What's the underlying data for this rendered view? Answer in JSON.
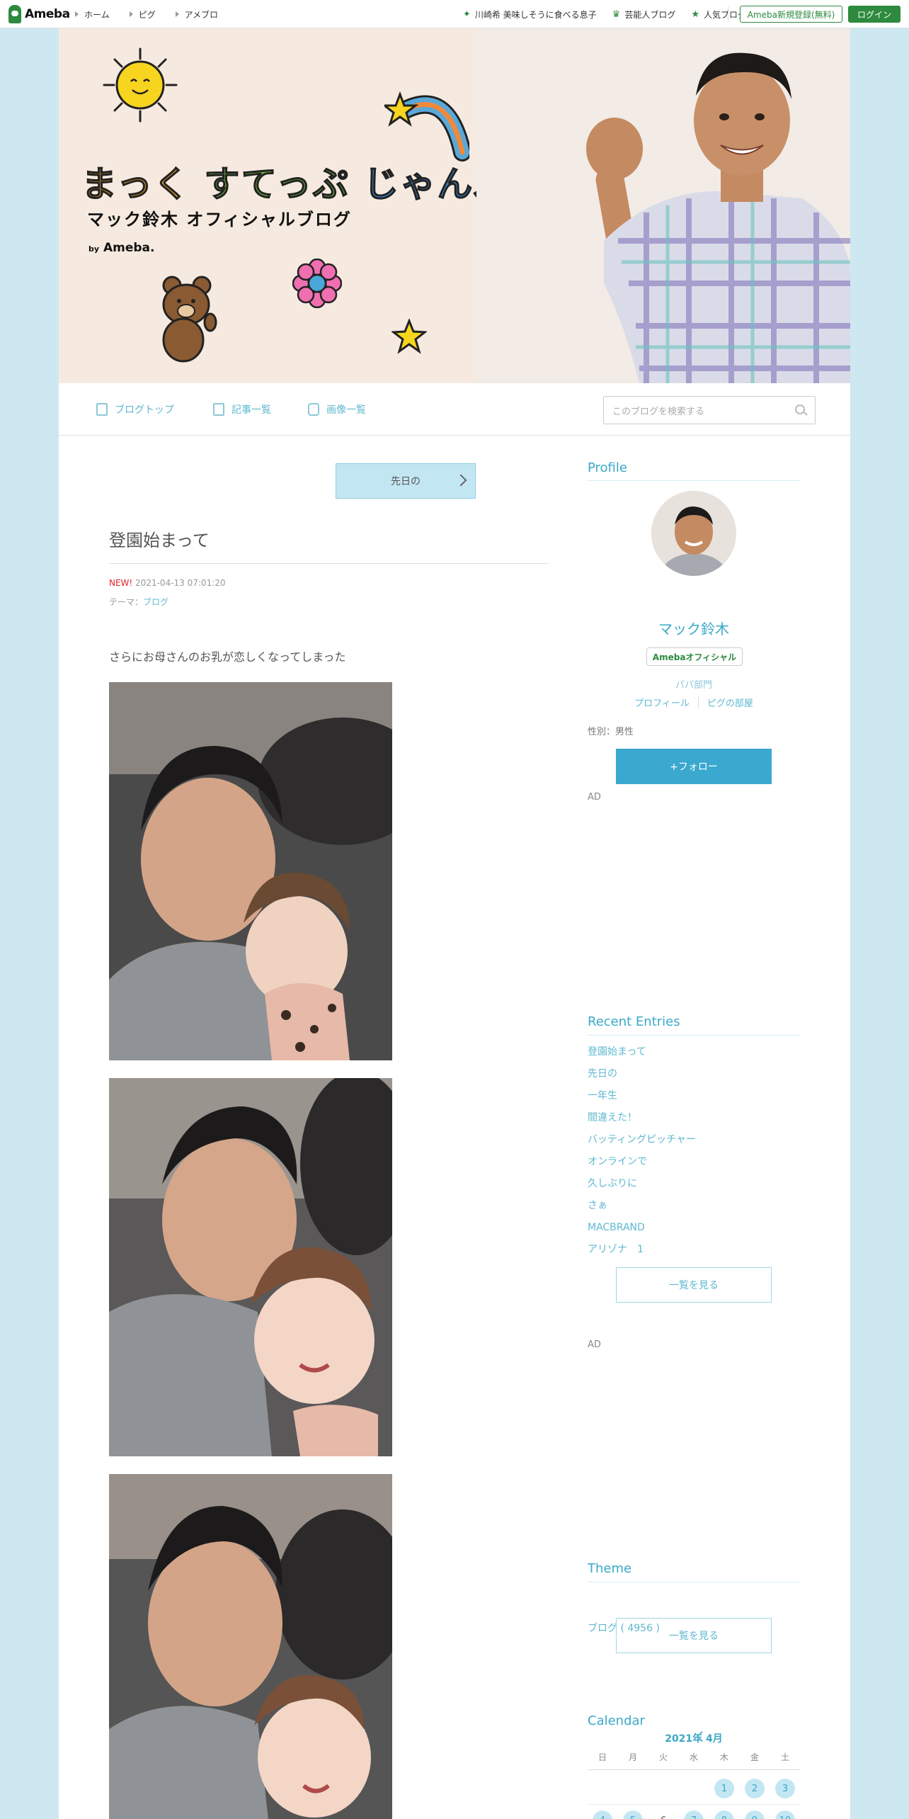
{
  "topbar": {
    "logo": "Ameba",
    "nav": [
      "ホーム",
      "ピグ",
      "アメブロ"
    ],
    "right_links": [
      "川崎希 美味しそうに食べる息子",
      "芸能人ブログ",
      "人気ブログ"
    ],
    "register_label": "Ameba新規登録(無料)",
    "login_label": "ログイン",
    "accent": "#2d8a3e"
  },
  "banner": {
    "title_part1": "まっく",
    "title_part2": "すてっぷ",
    "title_part3": "じゃんぷ",
    "subtitle": "マック鈴木 オフィシャルブログ",
    "by": "by",
    "brand": "Ameba."
  },
  "blognav": {
    "items": [
      "ブログトップ",
      "記事一覧",
      "画像一覧"
    ],
    "search_placeholder": "このブログを検索する"
  },
  "article": {
    "prev_label": "先日の",
    "title": "登園始まって",
    "new_label": "NEW!",
    "datetime": "2021-04-13 07:01:20",
    "theme_prefix": "テーマ：",
    "theme": "ブログ",
    "text": "さらにお母さんのお乳が恋しくなってしまった"
  },
  "sidebar": {
    "profile_heading": "Profile",
    "name": "マック鈴木",
    "official_badge": "Amebaオフィシャル",
    "category": "パパ部門",
    "profile_link": "プロフィール",
    "pig_link": "ピグの部屋",
    "gender": "性別：男性",
    "follow_label": "+フォロー",
    "ad_label": "AD",
    "recent_heading": "Recent Entries",
    "recent": [
      "登園始まって",
      "先日の",
      "一年生",
      "間違えた！",
      "バッティングピッチャー",
      "オンラインで",
      "久しぶりに",
      "さぁ",
      "MACBRAND",
      "アリゾナ　1"
    ],
    "more_label": "一覧を見る",
    "theme_heading": "Theme",
    "theme_item": "ブログ ( 4956 )",
    "calendar_heading": "Calendar",
    "calendar_month": "2021年 4月",
    "weekdays": [
      "日",
      "月",
      "火",
      "水",
      "木",
      "金",
      "土"
    ],
    "days": [
      "1",
      "2",
      "3",
      "4",
      "5",
      "6",
      "7",
      "8",
      "9",
      "10"
    ]
  }
}
